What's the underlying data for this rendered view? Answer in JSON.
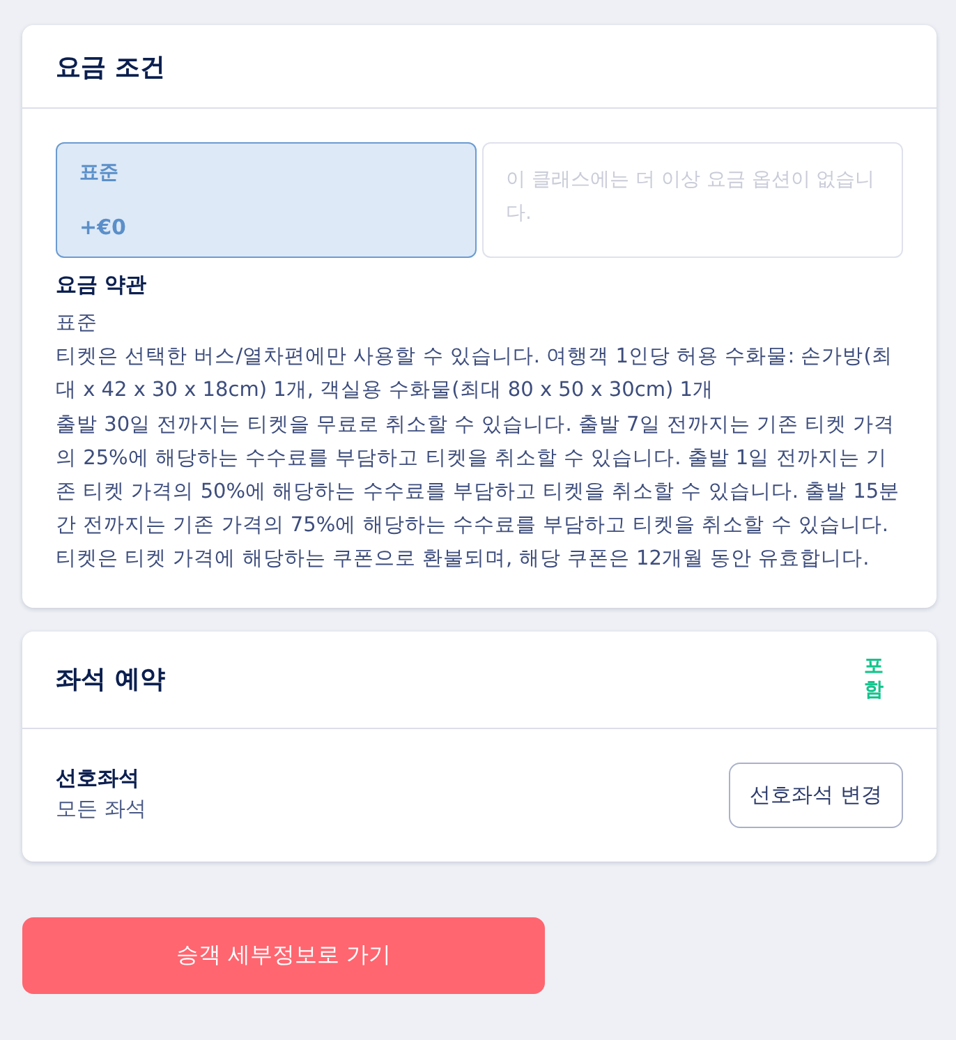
{
  "fare_conditions": {
    "title": "요금 조건",
    "options": [
      {
        "label": "표준",
        "price": "+€0",
        "selected": true
      }
    ],
    "no_more_options": "이 클래스에는 더 이상 요금 옵션이 없습니다.",
    "terms": {
      "title": "요금 약관",
      "paragraphs": [
        "표준",
        "티켓은 선택한 버스/열차편에만 사용할 수 있습니다. 여행객 1인당 허용 수화물: 손가방(최대 x 42 x 30 x 18cm) 1개, 객실용 수화물(최대 80 x 50 x 30cm) 1개",
        "출발 30일 전까지는 티켓을 무료로 취소할 수 있습니다. 출발 7일 전까지는 기존 티켓 가격의 25%에 해당하는 수수료를 부담하고 티켓을 취소할 수 있습니다. 출발 1일 전까지는 기존 티켓 가격의 50%에 해당하는 수수료를 부담하고 티켓을 취소할 수 있습니다. 출발 15분간 전까지는 기존 가격의 75%에 해당하는 수수료를 부담하고 티켓을 취소할 수 있습니다. 티켓은 티켓 가격에 해당하는 쿠폰으로 환불되며, 해당 쿠폰은 12개월 동안 유효합니다."
      ]
    }
  },
  "seat_reservation": {
    "title": "좌석 예약",
    "badge": "포함",
    "preference": {
      "label": "선호좌석",
      "value": "모든 좌석"
    },
    "change_button": "선호좌석 변경"
  },
  "primary_button": "승객 세부정보로 가기"
}
